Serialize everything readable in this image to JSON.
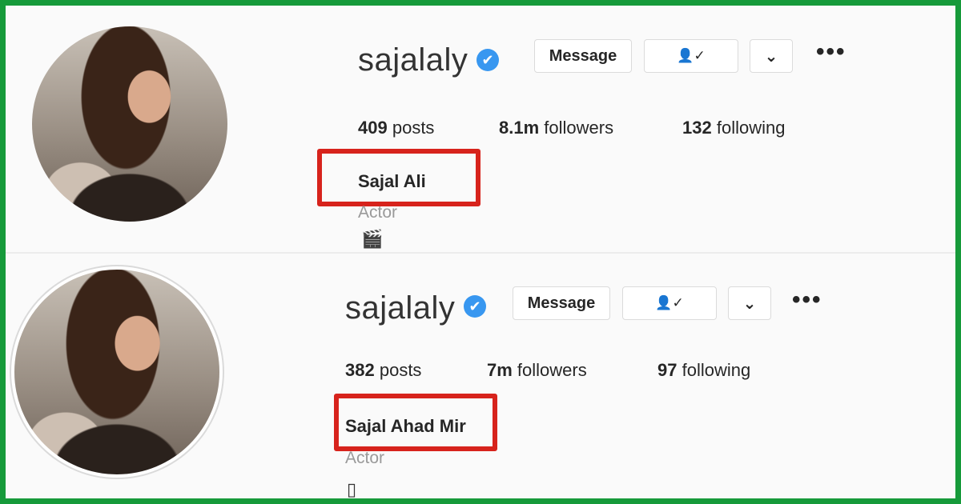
{
  "profiles": [
    {
      "username": "sajalaly",
      "verified_glyph": "✔",
      "message_label": "Message",
      "follow_glyph": "👤✓",
      "dropdown_glyph": "⌄",
      "more_glyph": "•••",
      "posts_count": "409",
      "posts_label": "posts",
      "followers_count": "8.1m",
      "followers_label": "followers",
      "following_count": "132",
      "following_label": "following",
      "full_name": "Sajal Ali",
      "bio": "Actor",
      "bio_emoji": "🎬"
    },
    {
      "username": "sajalaly",
      "verified_glyph": "✔",
      "message_label": "Message",
      "follow_glyph": "👤✓",
      "dropdown_glyph": "⌄",
      "more_glyph": "•••",
      "posts_count": "382",
      "posts_label": "posts",
      "followers_count": "7m",
      "followers_label": "followers",
      "following_count": "97",
      "following_label": "following",
      "full_name": "Sajal Ahad Mir",
      "bio": "Actor",
      "bio_emoji": "▯"
    }
  ],
  "colors": {
    "frame": "#169a3a",
    "highlight": "#d7231c",
    "verified": "#3897f0"
  }
}
